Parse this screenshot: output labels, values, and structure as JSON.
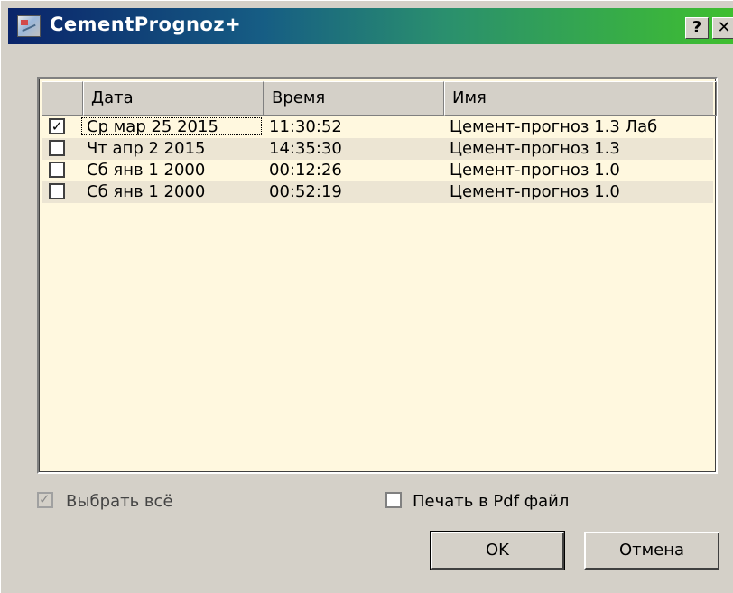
{
  "window": {
    "title": "CementPrognoz+"
  },
  "titlebar": {
    "help_label": "?",
    "close_label": "✕"
  },
  "table": {
    "columns": [
      "Дата",
      "Время",
      "Имя"
    ],
    "rows": [
      {
        "checked": true,
        "checkmark": "✓",
        "date": "Ср мар 25 2015",
        "time": "11:30:52",
        "name": "Цемент-прогноз 1.3 Лаб"
      },
      {
        "checked": false,
        "checkmark": "",
        "date": "Чт апр 2 2015",
        "time": "14:35:30",
        "name": "Цемент-прогноз 1.3"
      },
      {
        "checked": false,
        "checkmark": "",
        "date": "Сб янв 1 2000",
        "time": "00:12:26",
        "name": "Цемент-прогноз 1.0"
      },
      {
        "checked": false,
        "checkmark": "",
        "date": "Сб янв 1 2000",
        "time": "00:52:19",
        "name": "Цемент-прогноз 1.0"
      }
    ]
  },
  "options": {
    "select_all": {
      "label": "Выбрать всё",
      "checked": true,
      "enabled": false,
      "checkmark": "✓"
    },
    "print_pdf": {
      "label": "Печать в Pdf файл",
      "checked": false
    }
  },
  "buttons": {
    "ok": "OK",
    "cancel": "Отмена"
  },
  "colors": {
    "title_gradient_start": "#0a246a",
    "title_gradient_end": "#3fbf2f",
    "list_background": "#fff8df",
    "alt_row": "#ece5d3",
    "face": "#d4d0c8"
  }
}
